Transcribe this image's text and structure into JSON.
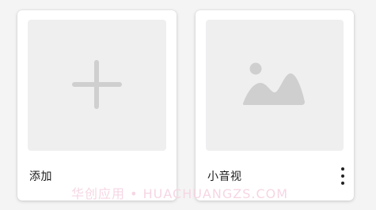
{
  "cards": [
    {
      "label": "添加",
      "icon": "plus-icon",
      "colors": {
        "icon": "#cfcfd0",
        "thumb": "#efeff0"
      }
    },
    {
      "label": "小音视",
      "icon": "image-placeholder-icon",
      "menu_icon": "more-vertical-icon"
    }
  ],
  "watermark": "华创应用 • HUACHUANGZS.COM"
}
